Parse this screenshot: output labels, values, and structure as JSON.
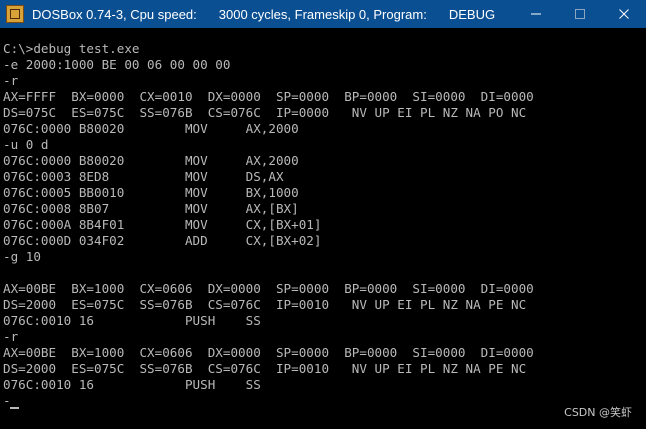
{
  "window": {
    "title_app": "DOSBox 0.74-3, Cpu speed:",
    "title_cycles": "3000 cycles, Frameskip  0, Program:",
    "title_program": "DEBUG"
  },
  "console_lines": [
    "C:\\>debug test.exe",
    "-e 2000:1000 BE 00 06 00 00 00",
    "-r",
    "AX=FFFF  BX=0000  CX=0010  DX=0000  SP=0000  BP=0000  SI=0000  DI=0000",
    "DS=075C  ES=075C  SS=076B  CS=076C  IP=0000   NV UP EI PL NZ NA PO NC",
    "076C:0000 B80020        MOV     AX,2000",
    "-u 0 d",
    "076C:0000 B80020        MOV     AX,2000",
    "076C:0003 8ED8          MOV     DS,AX",
    "076C:0005 BB0010        MOV     BX,1000",
    "076C:0008 8B07          MOV     AX,[BX]",
    "076C:000A 8B4F01        MOV     CX,[BX+01]",
    "076C:000D 034F02        ADD     CX,[BX+02]",
    "-g 10",
    "",
    "AX=00BE  BX=1000  CX=0606  DX=0000  SP=0000  BP=0000  SI=0000  DI=0000",
    "DS=2000  ES=075C  SS=076B  CS=076C  IP=0010   NV UP EI PL NZ NA PE NC",
    "076C:0010 16            PUSH    SS",
    "-r",
    "AX=00BE  BX=1000  CX=0606  DX=0000  SP=0000  BP=0000  SI=0000  DI=0000",
    "DS=2000  ES=075C  SS=076B  CS=076C  IP=0010   NV UP EI PL NZ NA PE NC",
    "076C:0010 16            PUSH    SS",
    "-"
  ],
  "watermark": "CSDN @笑虾",
  "icons": {
    "app": "dosbox-icon",
    "minimize": "minimize-icon",
    "maximize": "maximize-icon",
    "close": "close-icon"
  },
  "colors": {
    "titlebar": "#0b4f93",
    "console_bg": "#000000",
    "console_text": "#b9b9b9"
  }
}
